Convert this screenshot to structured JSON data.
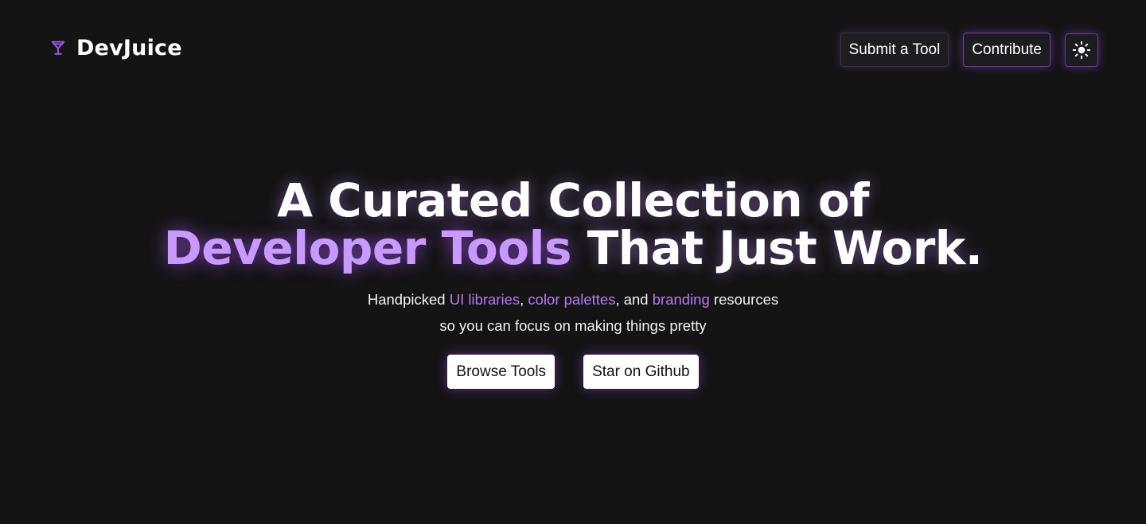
{
  "brand": {
    "name": "DevJuice",
    "icon": "cocktail-glass-icon",
    "accent_color": "#a855f7"
  },
  "nav": {
    "submit_label": "Submit a Tool",
    "contribute_label": "Contribute",
    "theme_icon": "sun-icon"
  },
  "hero": {
    "headline_line1": "A Curated Collection of",
    "headline_accent": "Developer Tools",
    "headline_rest": " That Just Work.",
    "subtitle": {
      "part1": "Handpicked ",
      "link1": "UI libraries",
      "sep1": ", ",
      "link2": "color palettes",
      "part2": ", and ",
      "link3": "branding",
      "part3": " resources",
      "line2": "so you can focus on making things pretty"
    },
    "browse_label": "Browse Tools",
    "github_label": "Star on Github"
  },
  "colors": {
    "background": "#141414",
    "accent": "#a855f7",
    "accent_light": "#c89aff",
    "link": "#b37cf2"
  }
}
